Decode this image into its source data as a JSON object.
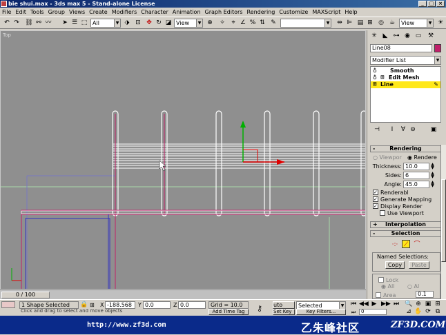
{
  "window": {
    "title": "bie shui.max - 3ds max 5 - Stand-alone License",
    "min": "_",
    "max": "□",
    "close": "×"
  },
  "menu": [
    "File",
    "Edit",
    "Tools",
    "Group",
    "Views",
    "Create",
    "Modifiers",
    "Character",
    "Animation",
    "Graph Editors",
    "Rendering",
    "Customize",
    "MAXScript",
    "Help"
  ],
  "toolbar": {
    "selection_filter": "All",
    "ref_coord": "View",
    "named_selection": "",
    "render_type": "View"
  },
  "viewport": {
    "label": "Top"
  },
  "command_panel": {
    "object_name": "Line08",
    "object_color": "#c0206a",
    "modifier_list": "Modifier List",
    "stack": [
      {
        "name": "Smooth",
        "selected": false
      },
      {
        "name": "Edit Mesh",
        "selected": false
      },
      {
        "name": "Line",
        "selected": true
      }
    ],
    "rendering": {
      "title": "Rendering",
      "viewport_label": "Viewpor",
      "renderer_label": "Rendere",
      "thickness_label": "Thickness:",
      "thickness": "10.0",
      "sides_label": "Sides:",
      "sides": "6",
      "angle_label": "Angle:",
      "angle": "45.0",
      "renderable": "Renderabl",
      "gen_mapping": "Generate Mapping",
      "display_render": "Display Render",
      "use_viewport": "Use Viewport"
    },
    "interpolation": {
      "title": "Interpolation"
    },
    "selection": {
      "title": "Selection",
      "named_selections": "Named Selections:",
      "copy": "Copy",
      "paste": "Paste",
      "lock": "Lock",
      "all": "All",
      "al": "Al",
      "area": "Area",
      "area_val": "0.1"
    }
  },
  "timeline": {
    "frame": "0 / 100"
  },
  "status": {
    "selection": "1 Shape Selected",
    "prompt": "Click and drag to select and move objects",
    "x_label": "X",
    "x": "-188.568",
    "y_label": "Y",
    "y": "0.0",
    "z_label": "Z",
    "z": "0.0",
    "grid": "Grid = 10.0",
    "auto_key": "uto Key",
    "set_key": "Set Key",
    "key_mode": "Selected",
    "key_filters": "Key Filters...",
    "add_time_tag": "Add Time Tag",
    "frame_field": "0"
  },
  "banner": {
    "url": "http://www.zf3d.com",
    "cn": "乙朱峰社区",
    "brand": "ZF3D.COM"
  }
}
